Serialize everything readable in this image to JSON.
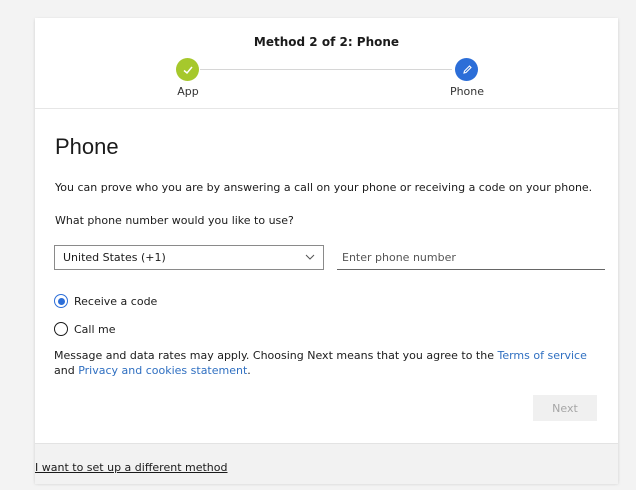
{
  "stepper": {
    "title": "Method 2 of 2: Phone",
    "steps": [
      {
        "label": "App",
        "state": "done",
        "icon": "checkmark-icon"
      },
      {
        "label": "Phone",
        "state": "current",
        "icon": "pencil-icon"
      }
    ]
  },
  "main": {
    "heading": "Phone",
    "description": "You can prove who you are by answering a call on your phone or receiving a code on your phone.",
    "question": "What phone number would you like to use?",
    "country_select": {
      "value": "United States (+1)"
    },
    "phone_input": {
      "placeholder": "Enter phone number",
      "value": ""
    },
    "options": [
      {
        "label": "Receive a code",
        "checked": true
      },
      {
        "label": "Call me",
        "checked": false
      }
    ],
    "notice": {
      "prefix": "Message and data rates may apply. Choosing Next means that you agree to the ",
      "terms_link": "Terms of service",
      "middle": " and ",
      "privacy_link": "Privacy and cookies statement",
      "suffix": "."
    },
    "next_label": "Next"
  },
  "footer": {
    "alt_method_link": "I want to set up a different method"
  },
  "colors": {
    "accent": "#2c6ed8",
    "done": "#a6c82c",
    "link": "#2f6fc1"
  }
}
